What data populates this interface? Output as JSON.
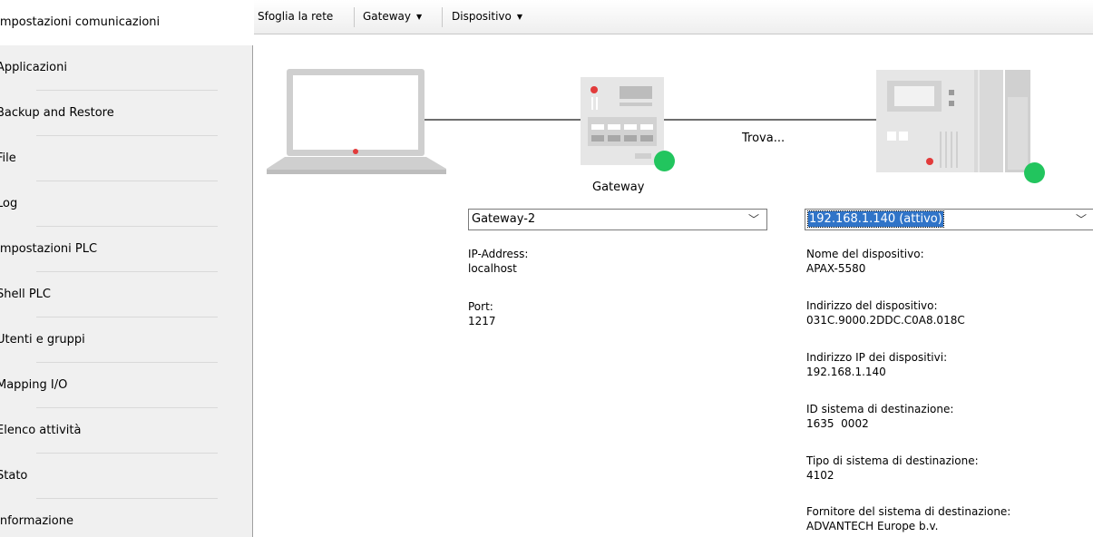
{
  "sidebar": {
    "items": [
      {
        "label": "Impostazioni comunicazioni",
        "active": true
      },
      {
        "label": "Applicazioni"
      },
      {
        "label": "Backup and Restore"
      },
      {
        "label": "File"
      },
      {
        "label": "Log"
      },
      {
        "label": "Impostazioni PLC"
      },
      {
        "label": "Shell PLC"
      },
      {
        "label": "Utenti e gruppi"
      },
      {
        "label": "Mapping I/O"
      },
      {
        "label": "Elenco attività"
      },
      {
        "label": "Stato"
      },
      {
        "label": "Informazione"
      }
    ]
  },
  "toolbar": {
    "browse_label": "Sfoglia la rete",
    "gateway_label": "Gateway",
    "device_label": "Dispositivo"
  },
  "diagram": {
    "gateway_caption": "Gateway",
    "scan_status": "Trova...",
    "gateway_status_color": "#22c55e",
    "device_status_color": "#22c55e"
  },
  "gateway_panel": {
    "selected": "Gateway-2",
    "ip_label": "IP-Address:",
    "ip_value": "localhost",
    "port_label": "Port:",
    "port_value": "1217"
  },
  "device_panel": {
    "selected": "192.168.1.140 (attivo)",
    "fields": [
      {
        "label": "Nome del dispositivo:",
        "value": "APAX-5580"
      },
      {
        "label": "Indirizzo del dispositivo:",
        "value": "031C.9000.2DDC.C0A8.018C"
      },
      {
        "label": "Indirizzo IP dei dispositivi:",
        "value": "192.168.1.140"
      },
      {
        "label": "ID sistema di destinazione:",
        "value": "1635  0002"
      },
      {
        "label": "Tipo di sistema di destinazione:",
        "value": "4102"
      },
      {
        "label": "Fornitore del sistema di destinazione:",
        "value": "ADVANTECH Europe b.v."
      }
    ]
  }
}
